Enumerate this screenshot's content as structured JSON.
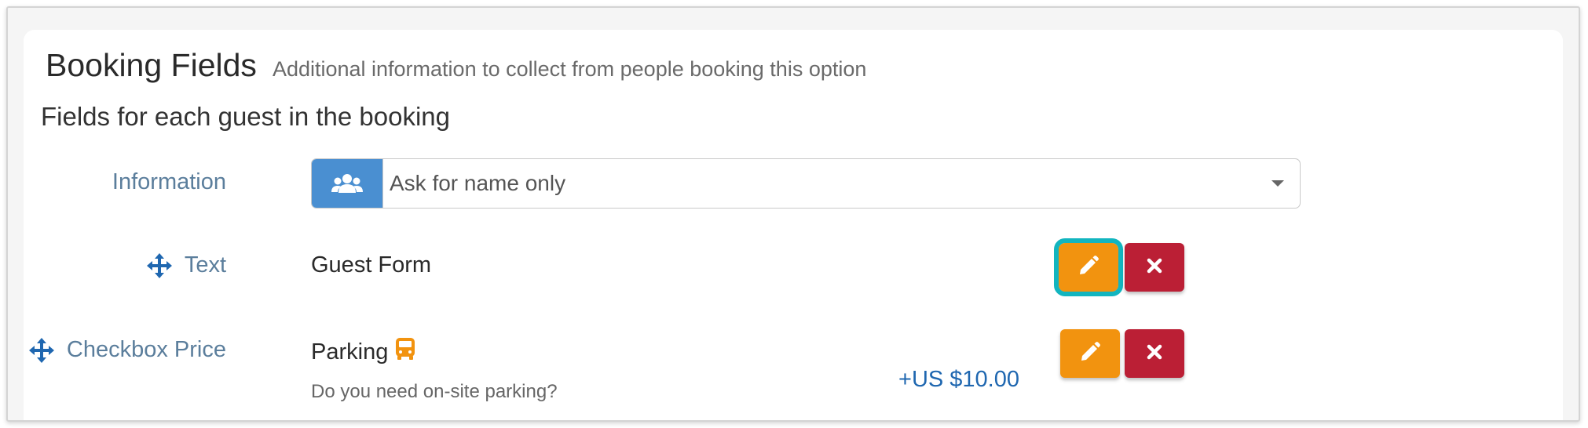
{
  "section": {
    "title": "Booking Fields",
    "subtitle": "Additional information to collect from people booking this option"
  },
  "group": {
    "title": "Fields for each guest in the booking"
  },
  "information_row": {
    "label": "Information",
    "addon_icon": "users-icon",
    "selected_value": "Ask for name only"
  },
  "fields": [
    {
      "type_label": "Text",
      "name": "Guest Form",
      "price": "",
      "help": "",
      "edit_icon": "pencil-icon",
      "delete_icon": "close-icon"
    },
    {
      "type_label": "Checkbox Price",
      "name": "Parking",
      "name_icon": "bus-icon",
      "price": "+US $10.00",
      "help": "Do you need on-site parking?",
      "edit_icon": "pencil-icon",
      "delete_icon": "close-icon"
    }
  ],
  "colors": {
    "label": "#5b7e9c",
    "addon": "#4a8fd1",
    "edit_button": "#f2930f",
    "delete_button": "#bb1f35",
    "focus_ring": "#12b5bf",
    "price": "#1f67b0",
    "bus_icon": "#f2930f"
  }
}
